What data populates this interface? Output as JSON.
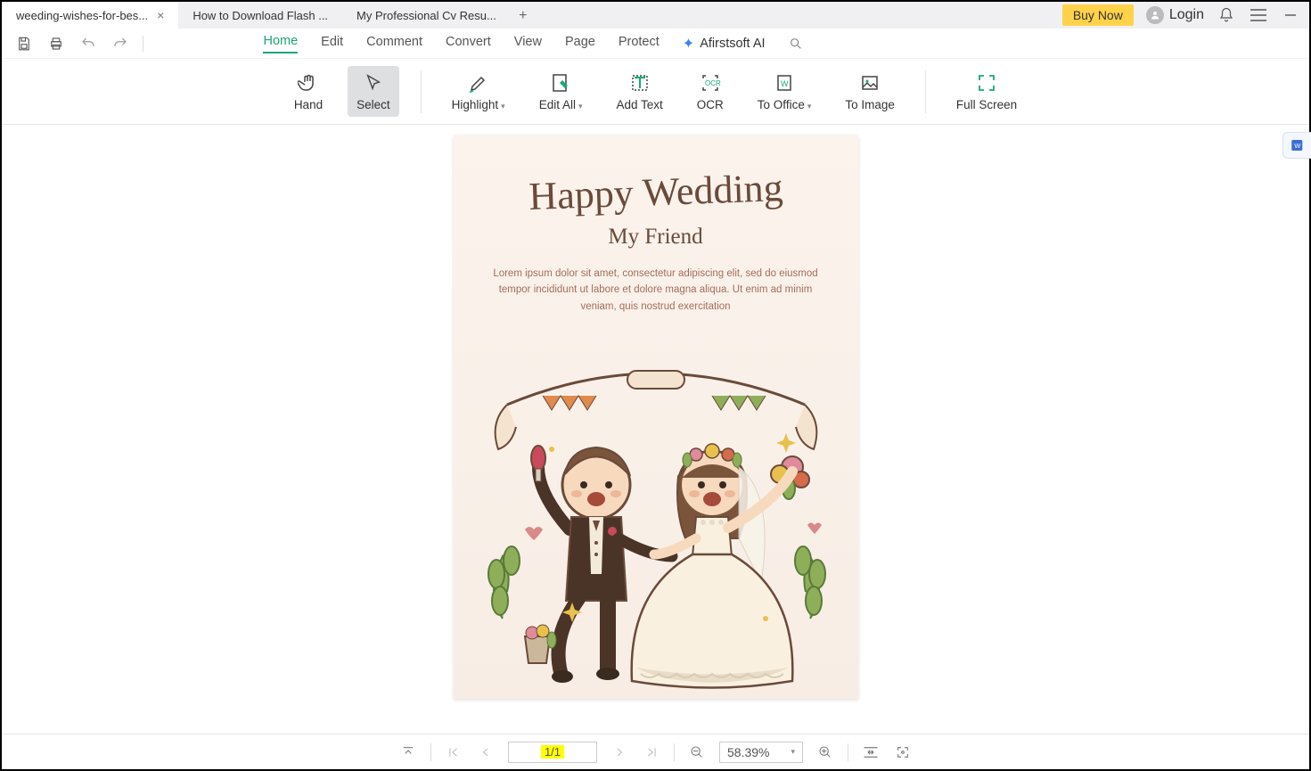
{
  "tabs": [
    {
      "label": "weeding-wishes-for-bes...",
      "active": true
    },
    {
      "label": "How to Download Flash ...",
      "active": false
    },
    {
      "label": "My Professional Cv Resu...",
      "active": false
    }
  ],
  "top": {
    "buy": "Buy Now",
    "login": "Login"
  },
  "menu": {
    "items": [
      "Home",
      "Edit",
      "Comment",
      "Convert",
      "View",
      "Page",
      "Protect"
    ],
    "active": "Home",
    "ai": "Afirstsoft AI"
  },
  "toolbar": {
    "hand": "Hand",
    "select": "Select",
    "highlight": "Highlight",
    "edit_all": "Edit All",
    "add_text": "Add Text",
    "ocr": "OCR",
    "to_office": "To Office",
    "to_image": "To Image",
    "full_screen": "Full Screen"
  },
  "document": {
    "title_script": "Happy Wedding",
    "subtitle": "My Friend",
    "body": "Lorem ipsum dolor sit amet, consectetur adipiscing elit, sed do eiusmod tempor incididunt ut labore et dolore magna aliqua. Ut enim ad minim veniam, quis nostrud exercitation"
  },
  "status": {
    "page": "1/1",
    "zoom": "58.39%"
  }
}
